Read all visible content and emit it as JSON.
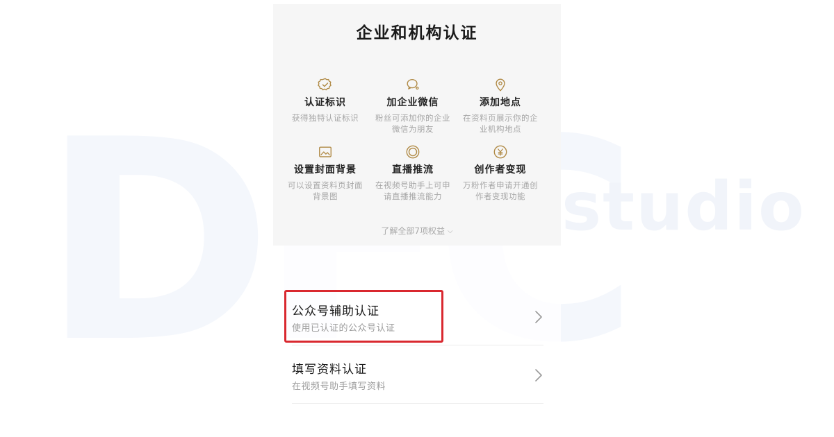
{
  "watermark": {
    "letters": "DFC",
    "studio": "studio"
  },
  "page": {
    "title": "企业和机构认证"
  },
  "benefits": [
    {
      "icon": "verified-badge-icon",
      "title": "认证标识",
      "desc": "获得独特认证标识"
    },
    {
      "icon": "wechat-chat-icon",
      "title": "加企业微信",
      "desc": "粉丝可添加你的企业微信为朋友"
    },
    {
      "icon": "location-pin-icon",
      "title": "添加地点",
      "desc": "在资料页展示你的企业机构地点"
    },
    {
      "icon": "image-icon",
      "title": "设置封面背景",
      "desc": "可以设置资料页封面背景图"
    },
    {
      "icon": "live-stream-icon",
      "title": "直播推流",
      "desc": "在视频号助手上可申请直播推流能力"
    },
    {
      "icon": "yuan-coin-icon",
      "title": "创作者变现",
      "desc": "万粉作者申请开通创作者变现功能"
    }
  ],
  "see_all": {
    "label": "了解全部7项权益",
    "icon": "chevron-down-icon"
  },
  "options": [
    {
      "title": "公众号辅助认证",
      "subtitle": "使用已认证的公众号认证",
      "icon": "chevron-right-icon",
      "highlighted": true
    },
    {
      "title": "填写资料认证",
      "subtitle": "在视频号助手填写资料",
      "icon": "chevron-right-icon",
      "highlighted": false
    }
  ],
  "colors": {
    "accent_gold": "#b08a45",
    "highlight_red": "#d9282f",
    "watermark_blue": "#f2f5fb"
  }
}
